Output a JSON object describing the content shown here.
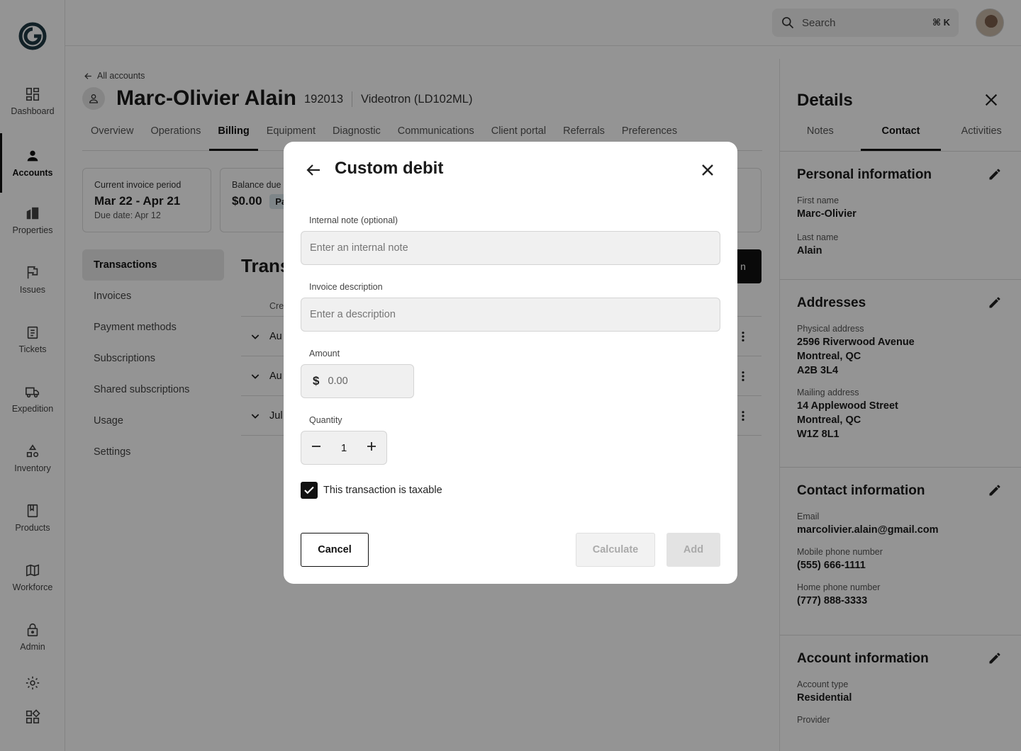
{
  "nav": {
    "items": [
      {
        "label": "Dashboard",
        "icon": "dashboard-icon"
      },
      {
        "label": "Accounts",
        "icon": "person-icon"
      },
      {
        "label": "Properties",
        "icon": "building-icon"
      },
      {
        "label": "Issues",
        "icon": "flag-icon"
      },
      {
        "label": "Tickets",
        "icon": "clipboard-icon"
      },
      {
        "label": "Expedition",
        "icon": "truck-icon"
      },
      {
        "label": "Inventory",
        "icon": "shapes-icon"
      },
      {
        "label": "Products",
        "icon": "book-icon"
      },
      {
        "label": "Workforce",
        "icon": "map-icon"
      },
      {
        "label": "Admin",
        "icon": "lock-icon"
      }
    ],
    "active": "Accounts"
  },
  "topbar": {
    "search_placeholder": "Search",
    "search_shortcut": "⌘ K"
  },
  "account": {
    "back_label": "All accounts",
    "name": "Marc-Olivier Alain",
    "id": "192013",
    "provider": "Videotron (LD102ML)",
    "tabs": [
      "Overview",
      "Operations",
      "Billing",
      "Equipment",
      "Diagnostic",
      "Communications",
      "Client portal",
      "Referrals",
      "Preferences"
    ],
    "active_tab": "Billing",
    "invoice_card": {
      "label": "Current invoice period",
      "value": "Mar 22 - Apr 21",
      "sub": "Due date: Apr 12"
    },
    "balance_card": {
      "label": "Balance due",
      "value": "$0.00",
      "badge": "Pa"
    },
    "subnav": [
      "Transactions",
      "Invoices",
      "Payment methods",
      "Subscriptions",
      "Shared subscriptions",
      "Usage",
      "Settings"
    ],
    "active_subnav": "Transactions",
    "section_title": "Trans",
    "action_button": "n",
    "tx_header": "Cre",
    "tx_rows": [
      "Au",
      "Au",
      "Jul"
    ]
  },
  "details": {
    "title": "Details",
    "tabs": [
      "Notes",
      "Contact",
      "Activities"
    ],
    "active_tab": "Contact",
    "personal": {
      "title": "Personal information",
      "first_name_label": "First name",
      "first_name": "Marc-Olivier",
      "last_name_label": "Last name",
      "last_name": "Alain"
    },
    "addresses": {
      "title": "Addresses",
      "physical_label": "Physical address",
      "physical_1": "2596 Riverwood Avenue",
      "physical_2": "Montreal, QC",
      "physical_3": "A2B 3L4",
      "mailing_label": "Mailing address",
      "mailing_1": "14 Applewood Street",
      "mailing_2": "Montreal, QC",
      "mailing_3": "W1Z 8L1"
    },
    "contact": {
      "title": "Contact information",
      "email_label": "Email",
      "email": "marcolivier.alain@gmail.com",
      "mobile_label": "Mobile phone number",
      "mobile": "(555) 666-1111",
      "home_label": "Home phone number",
      "home": "(777) 888-3333"
    },
    "account_info": {
      "title": "Account information",
      "type_label": "Account type",
      "type": "Residential",
      "provider_label": "Provider"
    }
  },
  "modal": {
    "title": "Custom debit",
    "note_label": "Internal note (optional)",
    "note_placeholder": "Enter an internal note",
    "desc_label": "Invoice description",
    "desc_placeholder": "Enter a description",
    "amount_label": "Amount",
    "currency": "$",
    "amount_placeholder": "0.00",
    "quantity_label": "Quantity",
    "quantity": "1",
    "taxable_label": "This transaction is taxable",
    "taxable_checked": true,
    "cancel_label": "Cancel",
    "calculate_label": "Calculate",
    "add_label": "Add"
  }
}
